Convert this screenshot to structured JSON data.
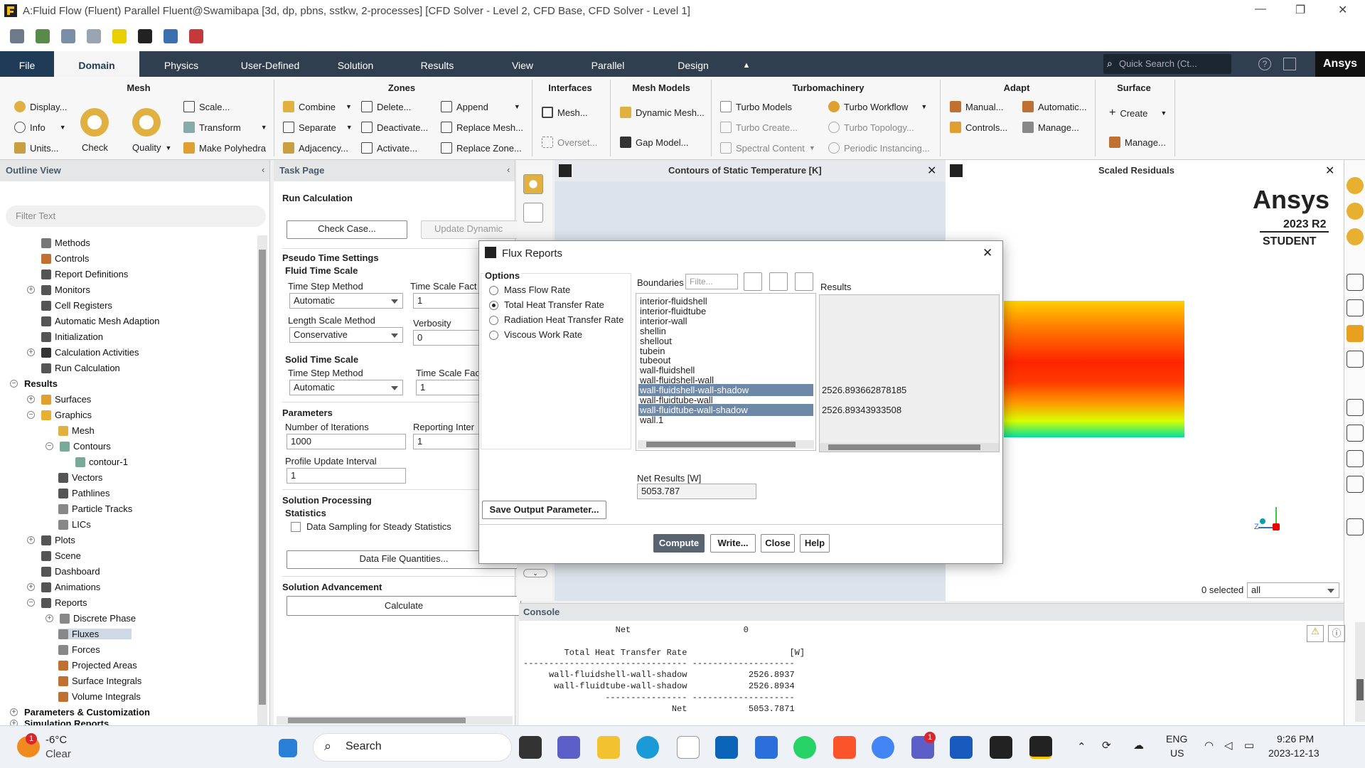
{
  "window": {
    "title": "A:Fluid Flow (Fluent) Parallel Fluent@Swamibapa  [3d, dp, pbns, sstkw, 2-processes] [CFD Solver - Level 2, CFD Base, CFD Solver - Level 1]"
  },
  "tabs": [
    "File",
    "Domain",
    "Physics",
    "User-Defined",
    "Solution",
    "Results",
    "View",
    "Parallel",
    "Design"
  ],
  "quick_search": "Quick Search (Ct...",
  "brand": "Ansys",
  "ribbon": {
    "mesh": {
      "title": "Mesh",
      "display": "Display...",
      "info": "Info",
      "units": "Units...",
      "check": "Check",
      "quality": "Quality",
      "scale": "Scale...",
      "transform": "Transform",
      "make_polyhedra": "Make Polyhedra"
    },
    "zones": {
      "title": "Zones",
      "combine": "Combine",
      "separate": "Separate",
      "adjacency": "Adjacency...",
      "delete": "Delete...",
      "deactivate": "Deactivate...",
      "activate": "Activate...",
      "append": "Append",
      "replace_mesh": "Replace Mesh...",
      "replace_zone": "Replace Zone..."
    },
    "interfaces": {
      "title": "Interfaces",
      "mesh": "Mesh...",
      "overset": "Overset..."
    },
    "mesh_models": {
      "title": "Mesh Models",
      "dynamic_mesh": "Dynamic Mesh...",
      "gap_model": "Gap Model..."
    },
    "turbo": {
      "title": "Turbomachinery",
      "turbo_models": "Turbo Models",
      "turbo_create": "Turbo Create...",
      "spectral": "Spectral Content",
      "turbo_workflow": "Turbo Workflow",
      "turbo_topology": "Turbo Topology...",
      "periodic": "Periodic Instancing..."
    },
    "adapt": {
      "title": "Adapt",
      "manual": "Manual...",
      "controls": "Controls...",
      "automatic": "Automatic...",
      "manage": "Manage..."
    },
    "surface": {
      "title": "Surface",
      "create": "Create",
      "manage": "Manage..."
    }
  },
  "outline": {
    "title": "Outline View",
    "filter_placeholder": "Filter Text",
    "items": [
      "Methods",
      "Controls",
      "Report Definitions",
      "Monitors",
      "Cell Registers",
      "Automatic Mesh Adaption",
      "Initialization",
      "Calculation Activities",
      "Run Calculation",
      "Results",
      "Surfaces",
      "Graphics",
      "Mesh",
      "Contours",
      "contour-1",
      "Vectors",
      "Pathlines",
      "Particle Tracks",
      "LICs",
      "Plots",
      "Scene",
      "Dashboard",
      "Animations",
      "Reports",
      "Discrete Phase",
      "Fluxes",
      "Forces",
      "Projected Areas",
      "Surface Integrals",
      "Volume Integrals",
      "Parameters & Customization",
      "Simulation Reports"
    ]
  },
  "task": {
    "title": "Task Page",
    "heading": "Run Calculation",
    "check_case": "Check Case...",
    "update_dynamic": "Update Dynamic Mes",
    "pseudo": "Pseudo Time Settings",
    "fluid_time_scale": "Fluid Time Scale",
    "time_step_method": "Time Step Method",
    "time_step_value": "Automatic",
    "time_scale_fact": "Time Scale Fact",
    "time_scale_value": "1",
    "length_scale_method": "Length Scale Method",
    "length_scale_value": "Conservative",
    "verbosity": "Verbosity",
    "verbosity_value": "0",
    "solid_time_scale": "Solid Time Scale",
    "solid_time_step_method": "Time Step Method",
    "solid_time_step_value": "Automatic",
    "solid_time_scale_fac": "Time Scale Fac",
    "solid_time_scale_value": "1",
    "parameters": "Parameters",
    "num_iter": "Number of Iterations",
    "num_iter_value": "1000",
    "reporting_inter": "Reporting Inter",
    "reporting_value": "1",
    "profile_update": "Profile Update Interval",
    "profile_update_value": "1",
    "solution_processing": "Solution Processing",
    "statistics": "Statistics",
    "data_sampling": "Data Sampling for Steady Statistics",
    "data_file_quantities": "Data File Quantities...",
    "solution_advancement": "Solution Advancement",
    "calculate": "Calculate"
  },
  "graphics": {
    "contour_title": "Contours of Static Temperature [K]",
    "residuals_title": "Scaled Residuals",
    "watermark_brand": "Ansys",
    "watermark_version": "2023 R2",
    "watermark_edition": "STUDENT",
    "selected": "0 selected",
    "filter_all": "all"
  },
  "dialog": {
    "title": "Flux Reports",
    "options_label": "Options",
    "options": [
      "Mass Flow Rate",
      "Total Heat Transfer Rate",
      "Radiation Heat Transfer Rate",
      "Viscous Work Rate"
    ],
    "selected_option": 1,
    "boundaries_label": "Boundaries",
    "boundaries_filter": "Filte...",
    "boundaries": [
      "interior-fluidshell",
      "interior-fluidtube",
      "interior-wall",
      "shellin",
      "shellout",
      "tubein",
      "tubeout",
      "wall-fluidshell",
      "wall-fluidshell-wall",
      "wall-fluidshell-wall-shadow",
      "wall-fluidtube-wall",
      "wall-fluidtube-wall-shadow",
      "wall.1"
    ],
    "selected_boundaries": [
      9,
      11
    ],
    "results_label": "Results",
    "result_1": "2526.893662878185",
    "result_2": "2526.89343933508",
    "net_label": "Net Results [W]",
    "net_value": "5053.787",
    "save_output": "Save Output Parameter...",
    "compute": "Compute",
    "write": "Write...",
    "close": "Close",
    "help": "Help"
  },
  "console": {
    "title": "Console",
    "lines": [
      "                  Net                      0",
      "",
      "        Total Heat Transfer Rate                    [W]",
      "-------------------------------- --------------------",
      "     wall-fluidshell-wall-shadow            2526.8937",
      "      wall-fluidtube-wall-shadow            2526.8934",
      "                ---------------- --------------------",
      "                             Net            5053.7871"
    ]
  },
  "taskbar": {
    "temp": "-6°C",
    "weather": "Clear",
    "search": "Search",
    "lang": "ENG",
    "region": "US",
    "time": "9:26 PM",
    "date": "2023-12-13",
    "notif_badge": "1",
    "teams_badge": "1"
  },
  "colors": {
    "tab_bar": "#2f3f4f",
    "selection": "#6e89a8",
    "accent": "#f6c000"
  }
}
